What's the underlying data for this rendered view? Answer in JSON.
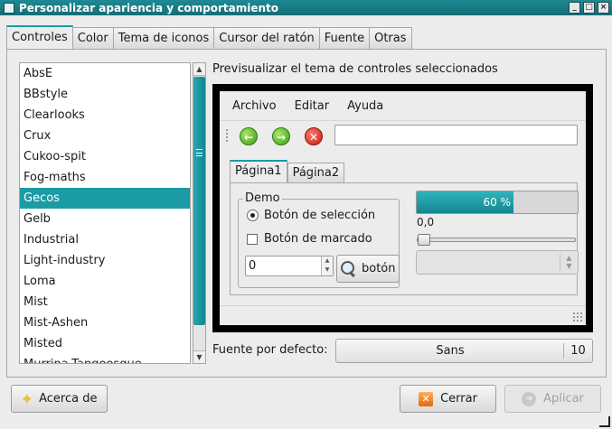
{
  "window": {
    "title": "Personalizar apariencia y comportamiento",
    "buttons": [
      "_",
      "□",
      "×"
    ]
  },
  "tabs": [
    {
      "label": "Controles",
      "active": true
    },
    {
      "label": "Color",
      "active": false
    },
    {
      "label": "Tema de iconos",
      "active": false
    },
    {
      "label": "Cursor del ratón",
      "active": false
    },
    {
      "label": "Fuente",
      "active": false
    },
    {
      "label": "Otras",
      "active": false
    }
  ],
  "theme_list": {
    "items": [
      "AbsE",
      "BBstyle",
      "Clearlooks",
      "Crux",
      "Cukoo-spit",
      "Fog-maths",
      "Gecos",
      "Gelb",
      "Industrial",
      "Light-industry",
      "Loma",
      "Mist",
      "Mist-Ashen",
      "Misted",
      "Murrina-Tangoesque"
    ],
    "selected": "Gecos"
  },
  "preview": {
    "label": "Previsualizar el tema de controles seleccionados",
    "menus": [
      "Archivo",
      "Editar",
      "Ayuda"
    ],
    "toolbar_icons": [
      "back-arrow-icon",
      "forward-arrow-icon",
      "stop-icon"
    ],
    "toolbar_glyphs": {
      "back": "←",
      "forward": "→",
      "stop": "✕"
    },
    "tabs": [
      {
        "label": "Página1",
        "active": true
      },
      {
        "label": "Página2",
        "active": false
      }
    ],
    "demo_group": {
      "legend": "Demo",
      "radio_label": "Botón de selección",
      "radio_checked": true,
      "checkbox_label": "Botón de marcado",
      "checkbox_checked": false,
      "spin_value": "0",
      "button_label": "botón"
    },
    "progress": {
      "value": 0.6,
      "text": "60 %"
    },
    "slider": {
      "value": 0.0,
      "text": "0,0"
    }
  },
  "font": {
    "label": "Fuente por defecto:",
    "name": "Sans",
    "size": "10"
  },
  "buttons": {
    "about": "Acerca de",
    "close": "Cerrar",
    "apply": "Aplicar"
  },
  "colors": {
    "accent": "#1b9ba4",
    "selection_text": "#ffffff"
  }
}
